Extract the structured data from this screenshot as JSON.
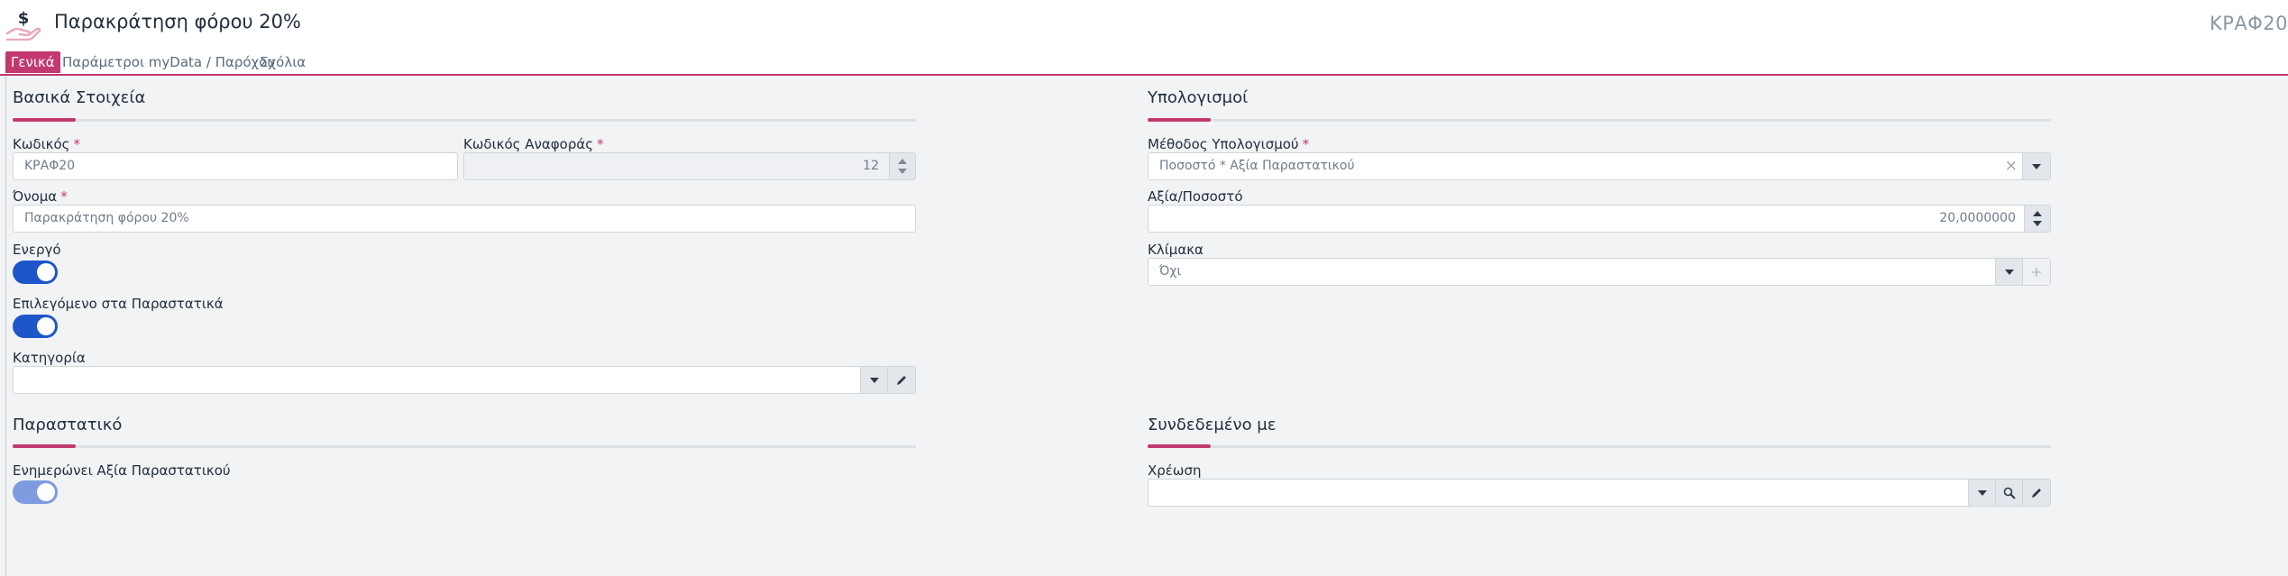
{
  "header": {
    "title": "Παρακράτηση φόρου 20%",
    "record_code": "ΚΡΑΦ20",
    "icon": "hand-money-icon",
    "icon_glyph": "$"
  },
  "tabs": [
    {
      "label": "Γενικά",
      "active": true
    },
    {
      "label": "Παράμετροι myData / Παρόχου",
      "active": false
    },
    {
      "label": "Σχόλια",
      "active": false
    }
  ],
  "basic": {
    "title": "Βασικά Στοιχεία",
    "code_label": "Κωδικός",
    "code_value": "ΚΡΑΦ20",
    "ref_code_label": "Κωδικός Αναφοράς",
    "ref_code_value": "12",
    "name_label": "Όνομα",
    "name_value": "Παρακράτηση φόρου 20%",
    "active_label": "Ενεργό",
    "active_on": true,
    "selected_label": "Επιλεγόμενο στα Παραστατικά",
    "selected_on": true,
    "category_label": "Κατηγορία",
    "category_value": ""
  },
  "calc": {
    "title": "Υπολογισμοί",
    "method_label": "Μέθοδος Υπολογισμού",
    "method_value": "Ποσοστό * Αξία Παραστατικού",
    "value_label": "Αξία/Ποσοστό",
    "value_value": "20,0000000",
    "scale_label": "Κλίμακα",
    "scale_value": "Όχι"
  },
  "document": {
    "title": "Παραστατικό",
    "update_label": "Ενημερώνει Αξία Παραστατικού",
    "update_on": true
  },
  "linked": {
    "title": "Συνδεδεμένο με",
    "debit_label": "Χρέωση",
    "debit_value": ""
  },
  "required_mark": "*",
  "colors": {
    "accent": "#c2396f",
    "toggle_on": "#1d56c9",
    "toggle_soft": "#7d9ce0"
  }
}
